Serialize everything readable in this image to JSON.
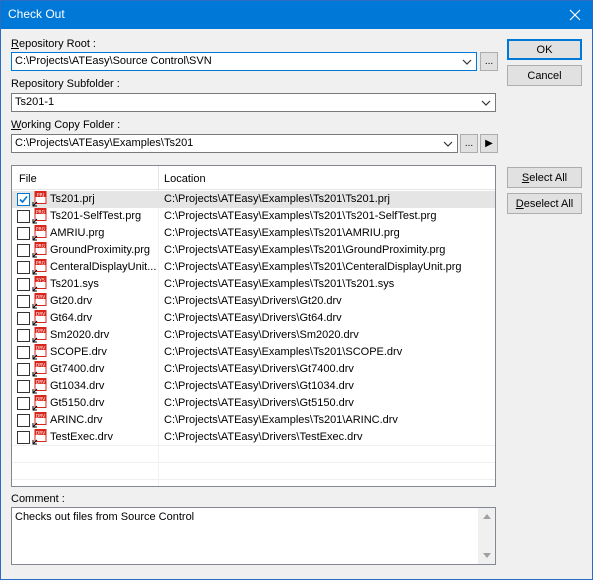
{
  "window": {
    "title": "Check Out"
  },
  "repo_root": {
    "label_pre": "R",
    "label_rest": "epository Root :",
    "value": "C:\\Projects\\ATEasy\\Source Control\\SVN",
    "browse": "..."
  },
  "repo_sub": {
    "label": "Repository Subfolder :",
    "value": "Ts201-1"
  },
  "working": {
    "label_pre": "W",
    "label_rest": "orking Copy Folder :",
    "value": "C:\\Projects\\ATEasy\\Examples\\Ts201",
    "browse": "...",
    "go": "▶"
  },
  "buttons": {
    "ok": "OK",
    "cancel": "Cancel",
    "select_pre": "S",
    "select_rest": "elect All",
    "deselect_pre": "D",
    "deselect_rest": "eselect All"
  },
  "list": {
    "headers": {
      "file": "File",
      "location": "Location"
    },
    "rows": [
      {
        "file": "Ts201.prj",
        "location": "C:\\Projects\\ATEasy\\Examples\\Ts201\\Ts201.prj",
        "checked": true,
        "icon": "prj-file-icon"
      },
      {
        "file": "Ts201-SelfTest.prg",
        "location": "C:\\Projects\\ATEasy\\Examples\\Ts201\\Ts201-SelfTest.prg",
        "checked": false,
        "icon": "prg-file-icon"
      },
      {
        "file": "AMRIU.prg",
        "location": "C:\\Projects\\ATEasy\\Examples\\Ts201\\AMRIU.prg",
        "checked": false,
        "icon": "prg-file-icon"
      },
      {
        "file": "GroundProximity.prg",
        "location": "C:\\Projects\\ATEasy\\Examples\\Ts201\\GroundProximity.prg",
        "checked": false,
        "icon": "prg-file-icon"
      },
      {
        "file": "CenteralDisplayUnit....",
        "location": "C:\\Projects\\ATEasy\\Examples\\Ts201\\CenteralDisplayUnit.prg",
        "checked": false,
        "icon": "prg-file-icon"
      },
      {
        "file": "Ts201.sys",
        "location": "C:\\Projects\\ATEasy\\Examples\\Ts201\\Ts201.sys",
        "checked": false,
        "icon": "sys-file-icon"
      },
      {
        "file": "Gt20.drv",
        "location": "C:\\Projects\\ATEasy\\Drivers\\Gt20.drv",
        "checked": false,
        "icon": "drv-file-icon"
      },
      {
        "file": "Gt64.drv",
        "location": "C:\\Projects\\ATEasy\\Drivers\\Gt64.drv",
        "checked": false,
        "icon": "drv-file-icon"
      },
      {
        "file": "Sm2020.drv",
        "location": "C:\\Projects\\ATEasy\\Drivers\\Sm2020.drv",
        "checked": false,
        "icon": "drv-file-icon"
      },
      {
        "file": "SCOPE.drv",
        "location": "C:\\Projects\\ATEasy\\Examples\\Ts201\\SCOPE.drv",
        "checked": false,
        "icon": "drv-file-icon"
      },
      {
        "file": "Gt7400.drv",
        "location": "C:\\Projects\\ATEasy\\Drivers\\Gt7400.drv",
        "checked": false,
        "icon": "drv-file-icon"
      },
      {
        "file": "Gt1034.drv",
        "location": "C:\\Projects\\ATEasy\\Drivers\\Gt1034.drv",
        "checked": false,
        "icon": "drv-file-icon"
      },
      {
        "file": "Gt5150.drv",
        "location": "C:\\Projects\\ATEasy\\Drivers\\Gt5150.drv",
        "checked": false,
        "icon": "drv-file-icon"
      },
      {
        "file": "ARINC.drv",
        "location": "C:\\Projects\\ATEasy\\Examples\\Ts201\\ARINC.drv",
        "checked": false,
        "icon": "drv-file-icon"
      },
      {
        "file": "TestExec.drv",
        "location": "C:\\Projects\\ATEasy\\Drivers\\TestExec.drv",
        "checked": false,
        "icon": "drv-file-icon"
      }
    ]
  },
  "comment": {
    "label": "Comment :",
    "value": "Checks out files from Source Control"
  },
  "colors": {
    "titlebar": "#0078d7",
    "accent": "#0078d7",
    "icon_red": "#d9261c"
  }
}
